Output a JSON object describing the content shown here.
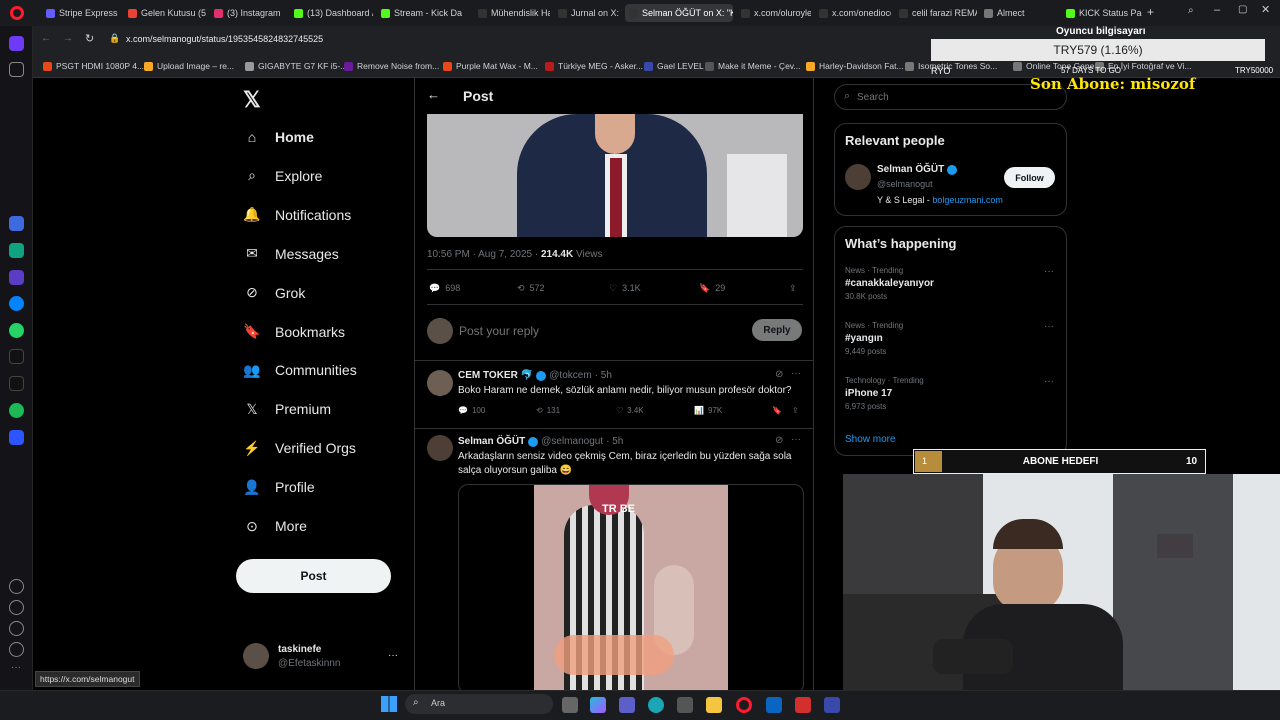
{
  "tabs": [
    {
      "label": "Stripe Express",
      "color": "#635bff"
    },
    {
      "label": "Gelen Kutusu (51",
      "color": "#ea4335"
    },
    {
      "label": "(3) Instagram",
      "color": "#e1306c"
    },
    {
      "label": "(13) Dashboard /",
      "color": "#53fc18"
    },
    {
      "label": "Stream - Kick Da",
      "color": "#53fc18"
    },
    {
      "label": "Mühendislik Han",
      "color": "#333"
    },
    {
      "label": "Jurnal on X: \"Did",
      "color": "#333"
    },
    {
      "label": "Selman ÖĞÜT on X: \"Kem",
      "color": "#333"
    },
    {
      "label": "x.com/oluroyle6",
      "color": "#333"
    },
    {
      "label": "x.com/onedioco",
      "color": "#333"
    },
    {
      "label": "celil farazi REMA",
      "color": "#333"
    },
    {
      "label": "Almect",
      "color": "#777"
    },
    {
      "label": "KICK Status Page",
      "color": "#53fc18"
    }
  ],
  "address": {
    "url": "x.com/selmanogut/status/1953545824832745525"
  },
  "bookmarks": [
    "PSGT HDMI 1080P 4...",
    "Upload Image – re...",
    "GIGABYTE G7 KF i5-...",
    "Remove Noise from...",
    "Purple Mat Wax - M...",
    "Türkiye MEG - Asker...",
    "Gael LEVEL",
    "Make it Meme - Çev...",
    "Harley-Davidson Fat...",
    "Isometric Tones So...",
    "Online Tone Genera...",
    "En İyi Fotoğraf ve Vi..."
  ],
  "nav": {
    "items": [
      "Home",
      "Explore",
      "Notifications",
      "Messages",
      "Grok",
      "Bookmarks",
      "Communities",
      "Premium",
      "Verified Orgs",
      "Profile",
      "More"
    ],
    "post_label": "Post",
    "account_name": "taskinefe",
    "account_handle": "@Efetaskinnn",
    "account_more": "···"
  },
  "header": {
    "back": "←",
    "title": "Post"
  },
  "post": {
    "timestamp": "10:56 PM · Aug 7, 2025 · ",
    "views_count": "214.4K",
    "views_label": " Views",
    "replies": "698",
    "reposts": "572",
    "likes": "3.1K",
    "bookmarks": "29"
  },
  "reply_box": {
    "placeholder": "Post your reply",
    "button": "Reply"
  },
  "replies": [
    {
      "name": "CEM TOKER",
      "emoji": "🐬",
      "handle": "@tokcem",
      "time": "· 5h",
      "text": "Boko Haram ne demek, sözlük anlamı nedir, biliyor musun profesör doktor?",
      "replies": "100",
      "reposts": "131",
      "likes": "3.4K",
      "views": "97K"
    },
    {
      "name": "Selman ÖĞÜT",
      "handle": "@selmanogut",
      "time": "· 5h",
      "text": "Arkadaşların sensiz video çekmiş Cem, biraz içerledin bu yüzden sağa sola salça oluyorsun galiba 😄",
      "video_watermark": "TR BE"
    }
  ],
  "search": {
    "placeholder": "Search"
  },
  "relevant": {
    "title": "Relevant people",
    "name": "Selman ÖĞÜT",
    "handle": "@selmanogut",
    "follow": "Follow",
    "bio_text": "Y & S Legal - ",
    "bio_link": "bolgeuzmani.com"
  },
  "happening": {
    "title": "What’s happening",
    "trends": [
      {
        "meta": "News · Trending",
        "name": "#canakkaleyanıyor",
        "count": "30.8K posts"
      },
      {
        "meta": "News · Trending",
        "name": "#yangın",
        "count": "9,449 posts"
      },
      {
        "meta": "Technology · Trending",
        "name": "iPhone 17",
        "count": "6,973 posts"
      }
    ],
    "show_more": "Show more"
  },
  "status_url": "https://x.com/selmanogut",
  "overlay": {
    "goal_title": "Oyuncu bilgisayarı",
    "goal_amount": "TRY579 (1.16%)",
    "goal_left": "RYO",
    "goal_days": "57 DAYS TO GO",
    "goal_right": "TRY50000",
    "last_sub": "Son Abone: misozof",
    "sub_goal_current": "1",
    "sub_goal_label": "ABONE HEDEFI",
    "sub_goal_target": "10"
  },
  "taskbar": {
    "search": "Ara"
  }
}
